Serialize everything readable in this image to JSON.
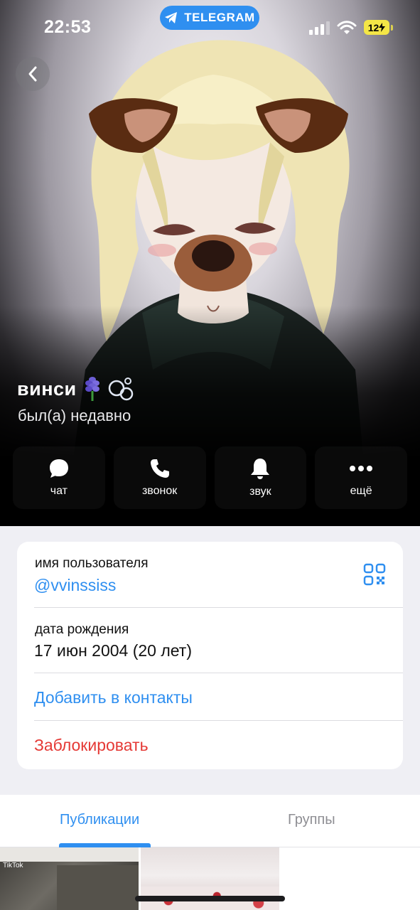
{
  "status_bar": {
    "time": "22:53",
    "telegram_label": "TELEGRAM",
    "battery": "12"
  },
  "profile": {
    "name": "винси",
    "emoji": "🪻🫧",
    "status": "был(а) недавно"
  },
  "actions": [
    {
      "label": "чат",
      "icon": "chat-bubble-icon"
    },
    {
      "label": "звонок",
      "icon": "phone-icon"
    },
    {
      "label": "звук",
      "icon": "bell-icon"
    },
    {
      "label": "ещё",
      "icon": "more-dots-icon"
    }
  ],
  "info": {
    "username_title": "имя пользователя",
    "username_value": "@vvinssiss",
    "birthday_title": "дата рождения",
    "birthday_value": "17 июн 2004 (20 лет)",
    "add_contact": "Добавить в контакты",
    "block": "Заблокировать"
  },
  "tabs": [
    {
      "label": "Публикации",
      "active": true
    },
    {
      "label": "Группы",
      "active": false
    }
  ],
  "thumbnails": {
    "first_watermark": "TikTok"
  },
  "colors": {
    "accent": "#2f8ff0",
    "danger": "#e53935",
    "background": "#efeff4",
    "battery": "#f4e646"
  }
}
